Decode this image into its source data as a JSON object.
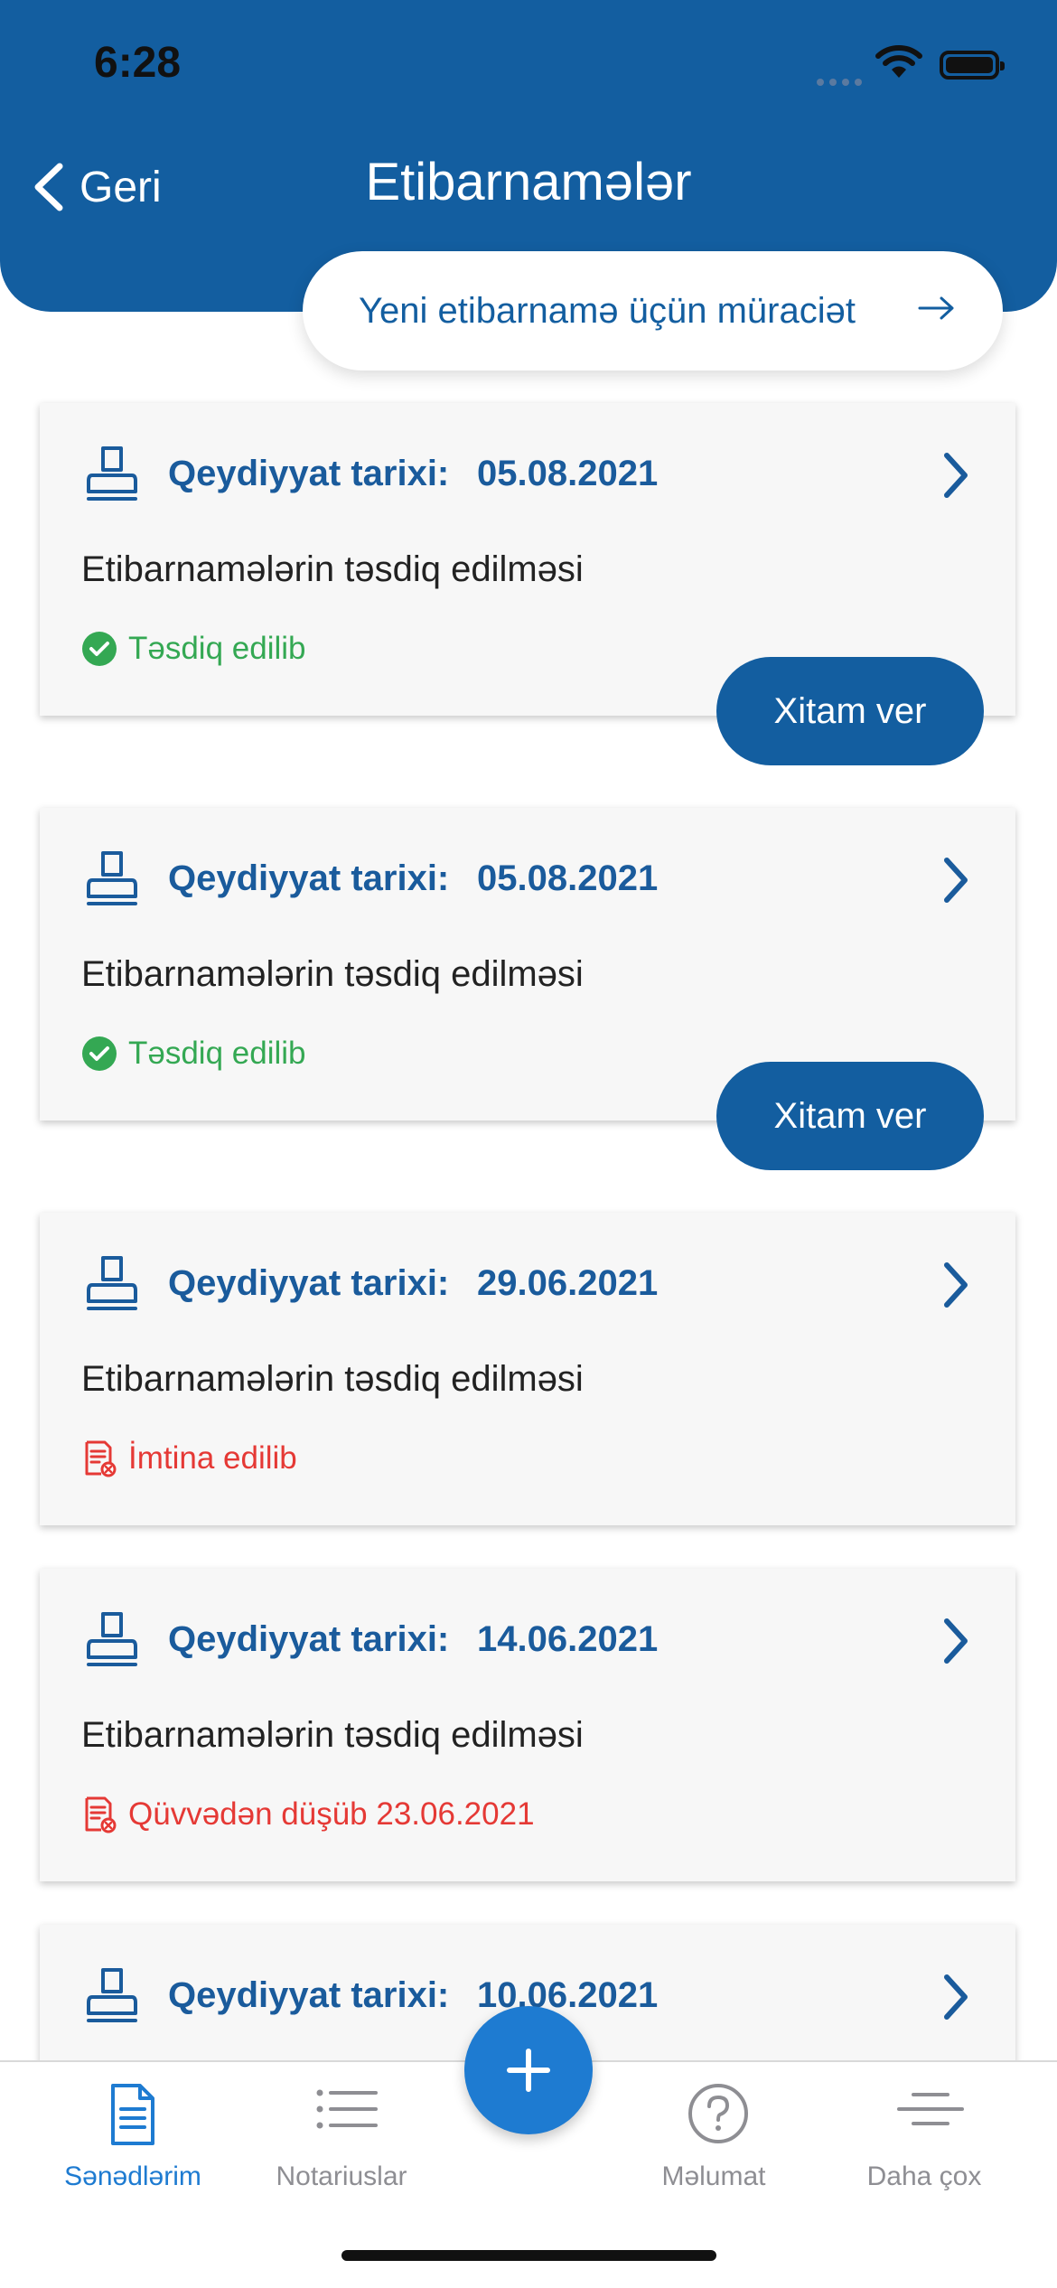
{
  "status_bar": {
    "time": "6:28"
  },
  "nav": {
    "back_label": "Geri",
    "title": "Etibarnamələr"
  },
  "new_request": {
    "label": "Yeni etibarnamə üçün müraciət"
  },
  "cards": [
    {
      "label": "Qeydiyyat tarixi:",
      "date": "05.08.2021",
      "description": "Etibarnamələrin təsdiq edilməsi",
      "status": "Təsdiq edilib",
      "status_type": "approved",
      "action": "Xitam ver"
    },
    {
      "label": "Qeydiyyat tarixi:",
      "date": "05.08.2021",
      "description": "Etibarnamələrin təsdiq edilməsi",
      "status": "Təsdiq edilib",
      "status_type": "approved",
      "action": "Xitam ver"
    },
    {
      "label": "Qeydiyyat tarixi:",
      "date": "29.06.2021",
      "description": "Etibarnamələrin təsdiq edilməsi",
      "status": "İmtina edilib",
      "status_type": "rejected"
    },
    {
      "label": "Qeydiyyat tarixi:",
      "date": "14.06.2021",
      "description": "Etibarnamələrin təsdiq edilməsi",
      "status": "Qüvvədən düşüb 23.06.2021",
      "status_type": "expired"
    },
    {
      "label": "Qeydiyyat tarixi:",
      "date": "10.06.2021"
    }
  ],
  "tabbar": {
    "tabs": [
      {
        "label": "Sənədlərim",
        "icon": "document-icon",
        "active": true
      },
      {
        "label": "Notariuslar",
        "icon": "list-icon",
        "active": false
      },
      {
        "label": "Məlumat",
        "icon": "question-icon",
        "active": false
      },
      {
        "label": "Daha çox",
        "icon": "menu-icon",
        "active": false
      }
    ],
    "add_icon": "plus-icon"
  },
  "colors": {
    "primary": "#135ea0",
    "accent": "#1e7bd1",
    "approved": "#34a853",
    "rejected": "#e53935"
  }
}
